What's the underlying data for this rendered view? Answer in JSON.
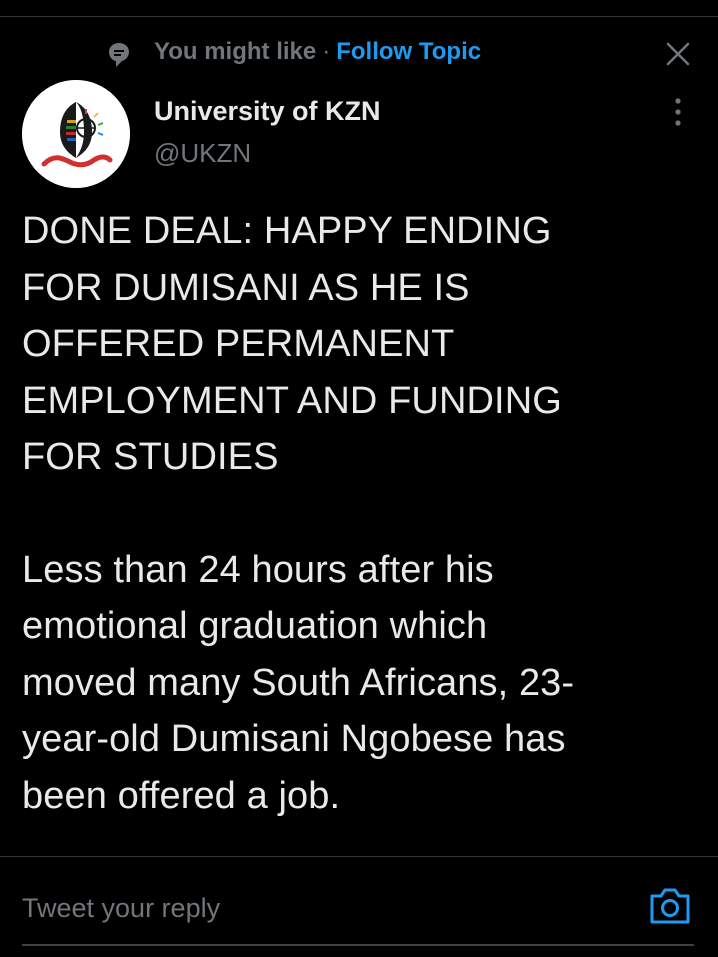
{
  "context": {
    "you_might_like": "You might like",
    "separator": "·",
    "follow_topic": "Follow Topic"
  },
  "author": {
    "name": "University of KZN",
    "handle": "@UKZN"
  },
  "tweet": {
    "headline_lines": [
      "DONE DEAL: HAPPY ENDING",
      "FOR DUMISANI AS HE IS",
      "OFFERED PERMANENT",
      "EMPLOYMENT AND FUNDING",
      "FOR STUDIES"
    ],
    "body_lines": [
      "Less than 24 hours after his",
      "emotional graduation which",
      "moved many South Africans, 23-",
      "year-old Dumisani Ngobese has",
      "been offered a job."
    ]
  },
  "reply": {
    "placeholder": "Tweet your reply"
  },
  "icons": {
    "topic": "topic-icon",
    "close": "close-icon",
    "more": "more-vertical-icon",
    "camera": "camera-icon",
    "avatar_logo": "ukzn-logo"
  },
  "colors": {
    "background": "#000000",
    "text_primary": "#e7e9ea",
    "text_secondary": "#71767b",
    "accent": "#1d9bf0",
    "divider": "#2f3336"
  }
}
